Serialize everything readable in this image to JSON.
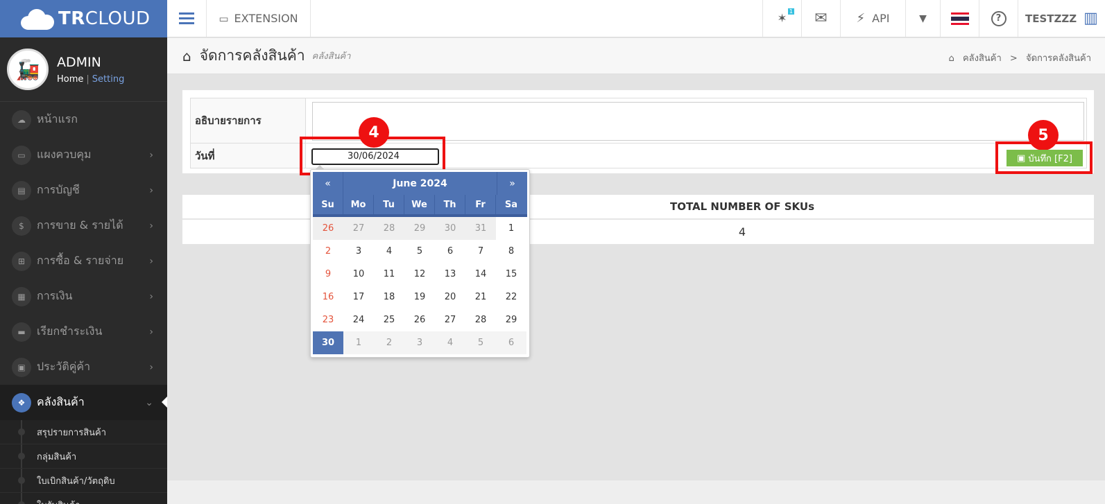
{
  "logo": {
    "brand_bold": "TR",
    "brand_rest": "CLOUD"
  },
  "profile": {
    "name": "ADMIN",
    "home": "Home",
    "sep": "|",
    "setting": "Setting"
  },
  "menu": [
    {
      "label": "หน้าแรก",
      "icon": "cloud-icon",
      "glyph": "☁"
    },
    {
      "label": "แผงควบคุม",
      "icon": "monitor-icon",
      "glyph": "▭"
    },
    {
      "label": "การบัญชี",
      "icon": "book-icon",
      "glyph": "▤"
    },
    {
      "label": "การขาย & รายได้",
      "icon": "dollar-icon",
      "glyph": "$"
    },
    {
      "label": "การซื้อ & รายจ่าย",
      "icon": "cart-icon",
      "glyph": "⊞"
    },
    {
      "label": "การเงิน",
      "icon": "calendar-icon",
      "glyph": "▦"
    },
    {
      "label": "เรียกชำระเงิน",
      "icon": "credit-card-icon",
      "glyph": "▬"
    },
    {
      "label": "ประวัติคู่ค้า",
      "icon": "contact-icon",
      "glyph": "▣"
    },
    {
      "label": "คลังสินค้า",
      "icon": "cubes-icon",
      "glyph": "❖"
    }
  ],
  "submenu": [
    "สรุปรายการสินค้า",
    "กลุ่มสินค้า",
    "ใบเบิกสินค้า/วัตถุดิบ",
    "ใบรับสินค้า"
  ],
  "topbar": {
    "extension": "EXTENSION",
    "api": "API",
    "user": "TESTZZZ",
    "notif_count": "1"
  },
  "header": {
    "title": "จัดการคลังสินค้า",
    "subtitle": "คลังสินค้า",
    "crumb1": "คลังสินค้า",
    "crumb_sep": ">",
    "crumb2": "จัดการคลังสินค้า"
  },
  "form": {
    "desc_label": "อธิบายรายการ",
    "date_label": "วันที่",
    "date_value": "30/06/2024",
    "save_label": "บันทึก [F2]"
  },
  "badges": {
    "step4": "4",
    "step5": "5"
  },
  "sku": {
    "header": "TOTAL NUMBER OF SKUs",
    "value": "4"
  },
  "calendar": {
    "prev": "«",
    "next": "»",
    "title": "June 2024",
    "dows": [
      "Su",
      "Mo",
      "Tu",
      "We",
      "Th",
      "Fr",
      "Sa"
    ],
    "weeks": [
      [
        "26",
        "27",
        "28",
        "29",
        "30",
        "31",
        "1"
      ],
      [
        "2",
        "3",
        "4",
        "5",
        "6",
        "7",
        "8"
      ],
      [
        "9",
        "10",
        "11",
        "12",
        "13",
        "14",
        "15"
      ],
      [
        "16",
        "17",
        "18",
        "19",
        "20",
        "21",
        "22"
      ],
      [
        "23",
        "24",
        "25",
        "26",
        "27",
        "28",
        "29"
      ],
      [
        "30",
        "1",
        "2",
        "3",
        "4",
        "5",
        "6"
      ]
    ],
    "selected": "30"
  },
  "colors": {
    "brand": "#4a74b8",
    "highlight": "#ee1111",
    "save": "#7cbd4a",
    "sunday": "#e4543c"
  }
}
